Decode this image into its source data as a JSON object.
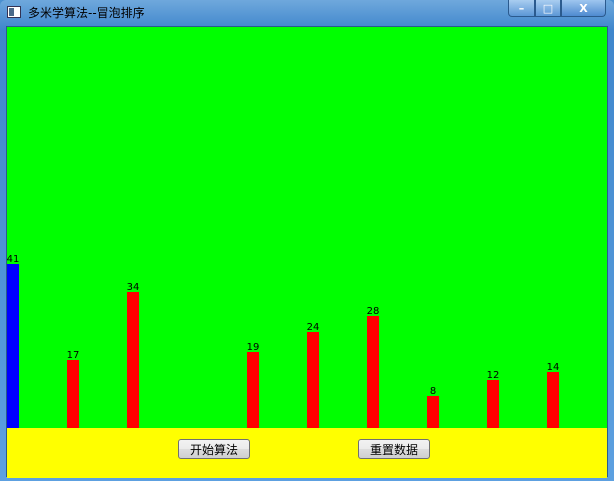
{
  "window": {
    "title": "多米学算法--冒泡排序",
    "minimize": "–",
    "maximize": "□",
    "close": "X"
  },
  "chart_data": {
    "type": "bar",
    "title": "",
    "values": [
      41,
      17,
      34,
      null,
      19,
      24,
      28,
      8,
      12,
      14
    ],
    "labels": [
      "41",
      "17",
      "34",
      "",
      "19",
      "24",
      "28",
      "8",
      "12",
      "14"
    ],
    "highlight_index": 0,
    "colors": {
      "highlight": "#0000ff",
      "normal": "#ff0000",
      "background": "#00ff00"
    }
  },
  "buttons": {
    "start": "开始算法",
    "reset": "重置数据"
  }
}
